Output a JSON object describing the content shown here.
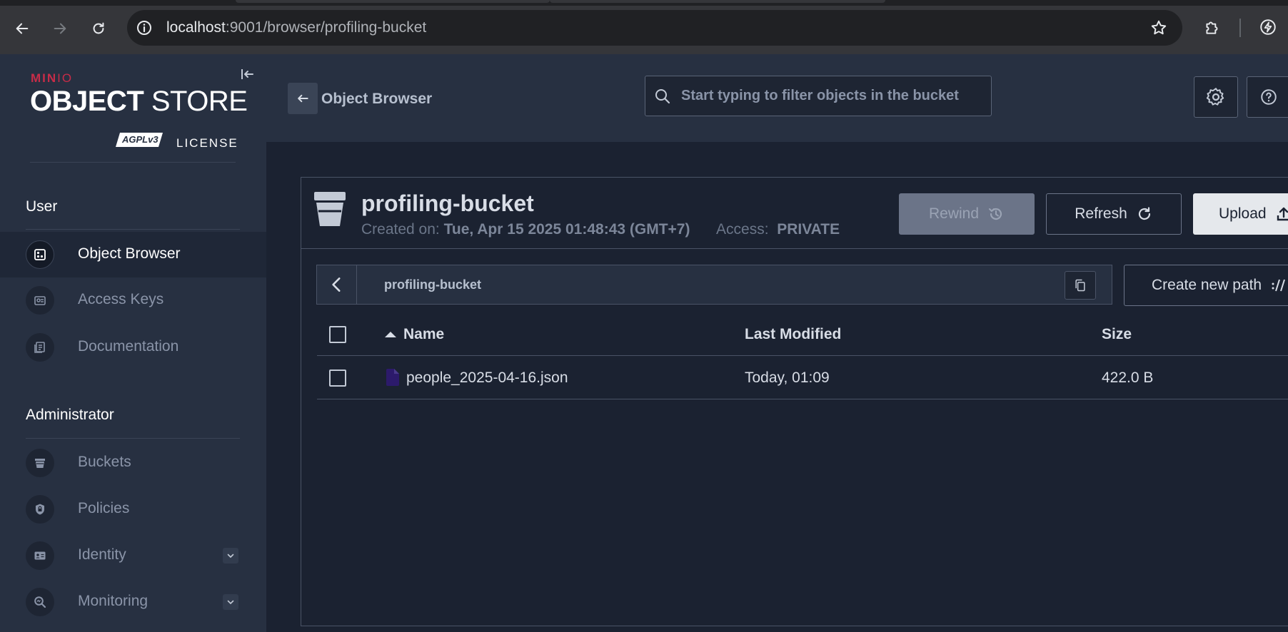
{
  "browser": {
    "url_host": "localhost",
    "url_rest": ":9001/browser/profiling-bucket"
  },
  "sidebar": {
    "logo": {
      "brand_min": "MIN",
      "brand_io": "IO",
      "product_bold": "OBJECT",
      "product_light": " STORE",
      "license_badge": "AGPLv3",
      "license_label": "LICENSE"
    },
    "user_section": {
      "title": "User",
      "items": [
        {
          "label": "Object Browser",
          "icon": "object-browser-icon",
          "active": true
        },
        {
          "label": "Access Keys",
          "icon": "access-keys-icon",
          "active": false
        },
        {
          "label": "Documentation",
          "icon": "documentation-icon",
          "active": false
        }
      ]
    },
    "admin_section": {
      "title": "Administrator",
      "items": [
        {
          "label": "Buckets",
          "icon": "bucket-icon",
          "expandable": false
        },
        {
          "label": "Policies",
          "icon": "policy-lock-icon",
          "expandable": false
        },
        {
          "label": "Identity",
          "icon": "identity-card-icon",
          "expandable": true
        },
        {
          "label": "Monitoring",
          "icon": "monitoring-search-icon",
          "expandable": true
        }
      ]
    }
  },
  "topbar": {
    "title": "Object Browser",
    "search_placeholder": "Start typing to filter objects in the bucket"
  },
  "bucket": {
    "name": "profiling-bucket",
    "created_label": "Created on:",
    "created_value": "Tue, Apr 15 2025 01:48:43 (GMT+7)",
    "access_label": "Access:",
    "access_value": "PRIVATE",
    "buttons": {
      "rewind": "Rewind",
      "refresh": "Refresh",
      "upload": "Upload"
    }
  },
  "path": {
    "current": "profiling-bucket",
    "create_new_path": "Create new path"
  },
  "table": {
    "columns": {
      "name": "Name",
      "modified": "Last Modified",
      "size": "Size"
    },
    "sort": {
      "column": "Name",
      "direction": "ascending"
    },
    "rows": [
      {
        "name": "people_2025-04-16.json",
        "modified": "Today, 01:09",
        "size": "422.0 B"
      }
    ]
  },
  "colors": {
    "sidebar_bg": "#273041",
    "main_bg": "#1b2231",
    "brand_red": "#c72c48",
    "file_icon": "#2c1a6b"
  }
}
